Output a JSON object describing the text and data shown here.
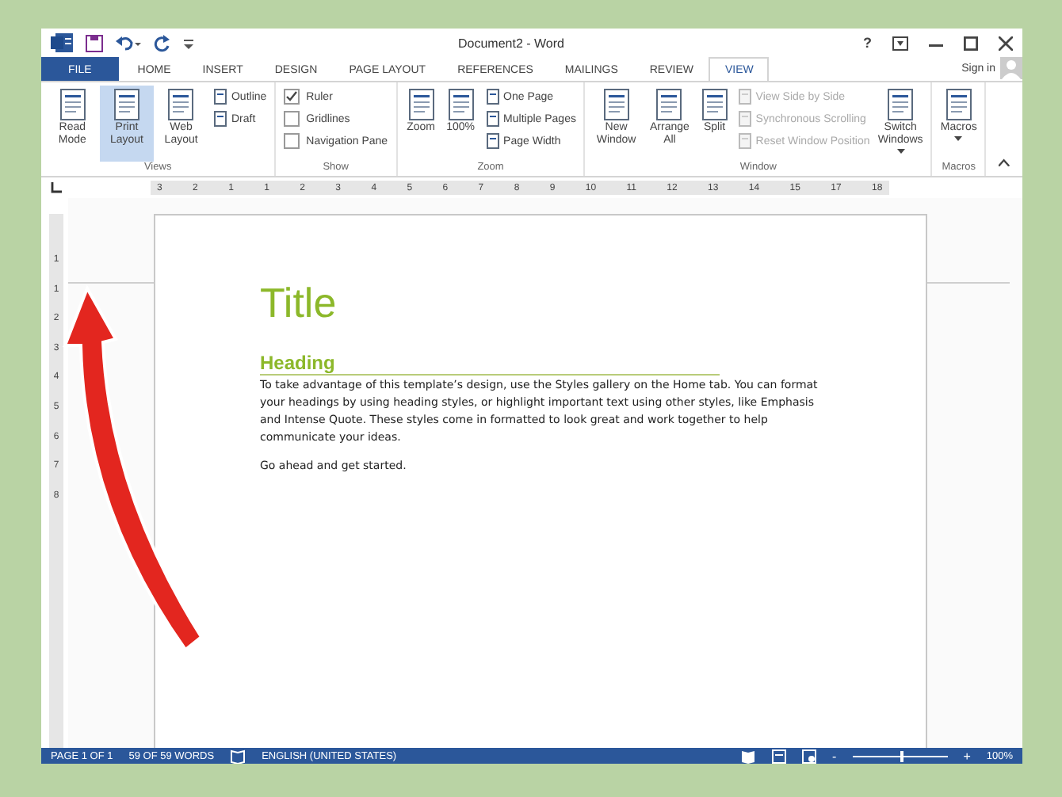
{
  "window": {
    "title": "Document2 - Word"
  },
  "title_buttons": [
    "?"
  ],
  "tabs": [
    {
      "label": "FILE",
      "selected": false,
      "kind": "file"
    },
    {
      "label": "HOME",
      "selected": false,
      "kind": "tab"
    },
    {
      "label": "INSERT",
      "selected": false,
      "kind": "tab"
    },
    {
      "label": "DESIGN",
      "selected": false,
      "kind": "tab"
    },
    {
      "label": "PAGE LAYOUT",
      "selected": false,
      "kind": "tab"
    },
    {
      "label": "REFERENCES",
      "selected": false,
      "kind": "tab"
    },
    {
      "label": "MAILINGS",
      "selected": false,
      "kind": "tab"
    },
    {
      "label": "REVIEW",
      "selected": false,
      "kind": "tab"
    },
    {
      "label": "VIEW",
      "selected": true,
      "kind": "tab"
    }
  ],
  "sign_in": "Sign in",
  "ribbon": {
    "groups": [
      {
        "label": "Views",
        "columns": [
          {
            "kind": "large",
            "label": "Read Mode",
            "selected": false
          },
          {
            "kind": "large",
            "label": "Print Layout",
            "selected": true
          },
          {
            "kind": "large",
            "label": "Web Layout",
            "selected": false
          },
          {
            "kind": "stack",
            "items": [
              {
                "kind": "small",
                "label": "Outline",
                "disabled": false
              },
              {
                "kind": "small",
                "label": "Draft",
                "disabled": false
              }
            ]
          }
        ]
      },
      {
        "label": "Show",
        "columns": [
          {
            "kind": "stack",
            "items": [
              {
                "kind": "check",
                "label": "Ruler",
                "checked": true
              },
              {
                "kind": "check",
                "label": "Gridlines",
                "checked": false
              },
              {
                "kind": "check",
                "label": "Navigation Pane",
                "checked": false
              }
            ]
          }
        ]
      },
      {
        "label": "Zoom",
        "columns": [
          {
            "kind": "large",
            "label": "Zoom",
            "selected": false
          },
          {
            "kind": "large",
            "label": "100%",
            "selected": false
          },
          {
            "kind": "stack",
            "items": [
              {
                "kind": "small",
                "label": "One Page",
                "disabled": false
              },
              {
                "kind": "small",
                "label": "Multiple Pages",
                "disabled": false
              },
              {
                "kind": "small",
                "label": "Page Width",
                "disabled": false
              }
            ]
          }
        ]
      },
      {
        "label": "Window",
        "columns": [
          {
            "kind": "large",
            "label": "New Window",
            "selected": false
          },
          {
            "kind": "large",
            "label": "Arrange All",
            "selected": false
          },
          {
            "kind": "large",
            "label": "Split",
            "selected": false
          },
          {
            "kind": "stack",
            "items": [
              {
                "kind": "small",
                "label": "View Side by Side",
                "disabled": true
              },
              {
                "kind": "small",
                "label": "Synchronous Scrolling",
                "disabled": true
              },
              {
                "kind": "small",
                "label": "Reset Window Position",
                "disabled": true
              }
            ]
          },
          {
            "kind": "large",
            "label": "Switch Windows",
            "selected": false,
            "dropdown": true
          }
        ]
      },
      {
        "label": "Macros",
        "columns": [
          {
            "kind": "large",
            "label": "Macros",
            "selected": false,
            "dropdown": true
          }
        ]
      }
    ]
  },
  "ruler": {
    "labels": [
      "3",
      "2",
      "1",
      "1",
      "2",
      "3",
      "4",
      "5",
      "6",
      "7",
      "8",
      "9",
      "10",
      "11",
      "12",
      "13",
      "14",
      "15",
      "17",
      "18"
    ]
  },
  "vertical_ruler": {
    "labels": [
      "1",
      "1",
      "2",
      "3",
      "4",
      "5",
      "6",
      "7",
      "8"
    ]
  },
  "document": {
    "title": "Title",
    "heading": "Heading",
    "paragraphs": [
      "To take advantage of this template’s design, use the Styles gallery on the Home tab. You can format your headings by using heading styles, or highlight important text using other styles, like Emphasis and Intense Quote. These styles come in formatted to look great and work together to help communicate your ideas.",
      "Go ahead and get started."
    ]
  },
  "status_bar": {
    "page": "PAGE 1 OF 1",
    "words": "59 OF 59 WORDS",
    "language": "ENGLISH (UNITED STATES)",
    "zoom_minus": "-",
    "zoom_plus": "+",
    "zoom": "100%",
    "zoom_slider": {
      "level": 0.5
    }
  }
}
